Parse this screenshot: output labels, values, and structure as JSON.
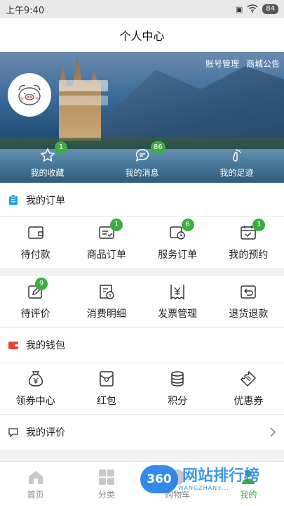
{
  "status": {
    "time": "上午9:40",
    "battery": "84"
  },
  "title": "个人中心",
  "hero": {
    "account_link": "账号管理",
    "notice_link": "商城公告",
    "nav": [
      {
        "label": "我的收藏",
        "badge": "1",
        "icon": "star-icon"
      },
      {
        "label": "我的消息",
        "badge": "86",
        "icon": "chat-icon"
      },
      {
        "label": "我的足迹",
        "badge": "",
        "icon": "footprint-icon"
      }
    ]
  },
  "orders": {
    "title": "我的订单",
    "items": [
      {
        "label": "待付款",
        "badge": "",
        "icon": "wallet-icon"
      },
      {
        "label": "商品订单",
        "badge": "1",
        "icon": "order-icon"
      },
      {
        "label": "服务订单",
        "badge": "6",
        "icon": "service-icon"
      },
      {
        "label": "我的预约",
        "badge": "3",
        "icon": "calendar-icon"
      }
    ]
  },
  "orders2": {
    "items": [
      {
        "label": "待评价",
        "badge": "9",
        "icon": "edit-icon"
      },
      {
        "label": "消费明细",
        "badge": "",
        "icon": "receipt-icon"
      },
      {
        "label": "发票管理",
        "badge": "",
        "icon": "invoice-icon"
      },
      {
        "label": "退货退款",
        "badge": "",
        "icon": "return-icon"
      }
    ]
  },
  "wallet": {
    "title": "我的钱包",
    "items": [
      {
        "label": "领券中心",
        "icon": "money-bag-icon"
      },
      {
        "label": "红包",
        "icon": "red-packet-icon"
      },
      {
        "label": "积分",
        "icon": "coins-icon"
      },
      {
        "label": "优惠券",
        "icon": "coupon-icon"
      }
    ]
  },
  "reviews": {
    "title": "我的评价"
  },
  "tabbar": [
    {
      "label": "首页",
      "icon": "home-icon"
    },
    {
      "label": "分类",
      "icon": "grid-icon"
    },
    {
      "label": "购物车",
      "icon": "cart-icon"
    },
    {
      "label": "我的",
      "icon": "user-icon"
    }
  ],
  "watermark": {
    "logo": "360",
    "text": "网站排行榜",
    "sub": "WANGZHAN3..."
  },
  "colors": {
    "badge": "#3bae3f",
    "wallet_accent": "#e8463e",
    "orders_accent": "#2ea0e0"
  }
}
